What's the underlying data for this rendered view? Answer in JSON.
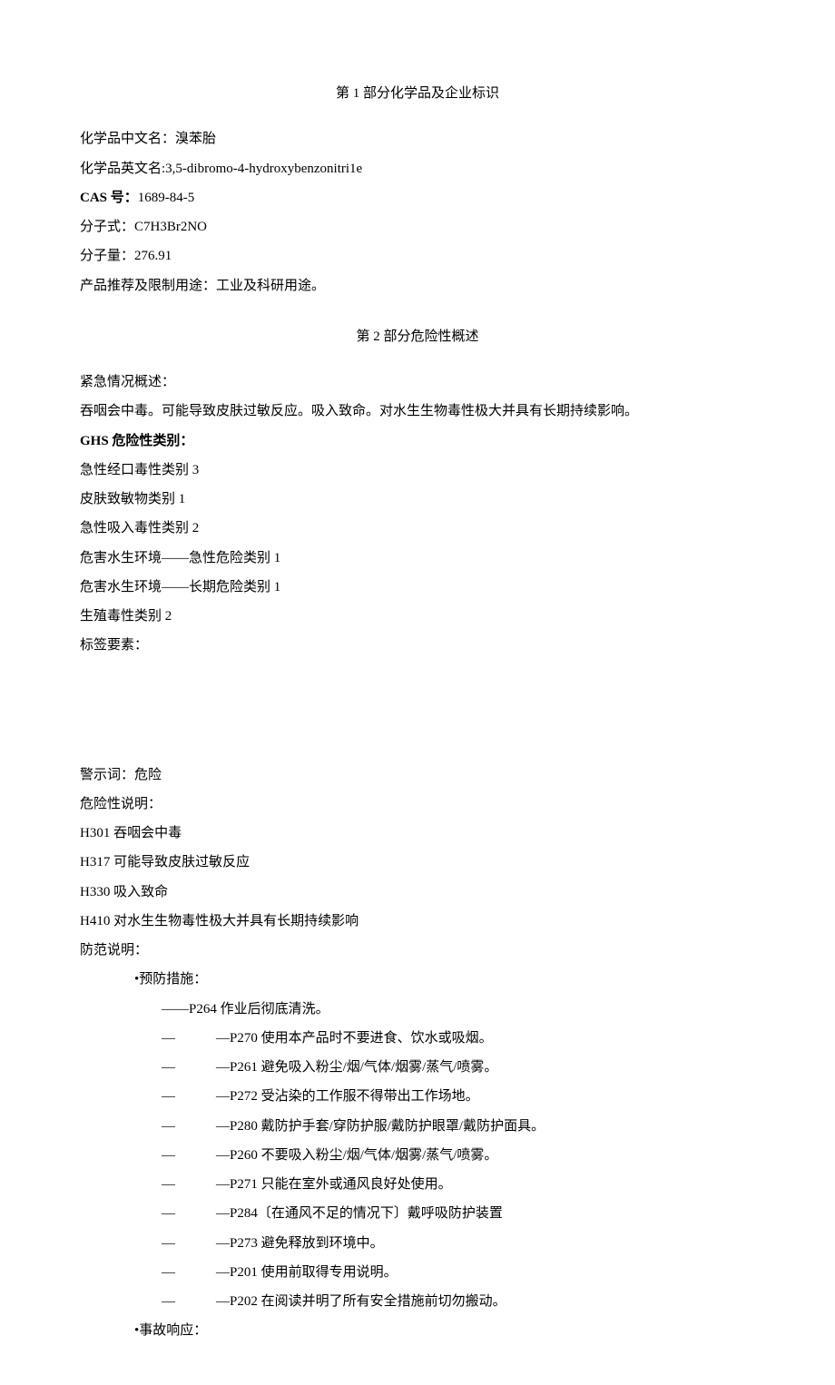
{
  "section1": {
    "title": "第 1 部分化学品及企业标识",
    "name_cn_label": "化学品中文名：",
    "name_cn": "溴苯胎",
    "name_en_label": "化学品英文名:",
    "name_en": "3,5-dibromo-4-hydroxybenzonitri1e",
    "cas_label": "CAS 号：",
    "cas": "1689-84-5",
    "formula_label": "分子式：",
    "formula": "C7H3Br2NO",
    "mw_label": "分子量：",
    "mw": "276.91",
    "usage_label": "产品推荐及限制用途：",
    "usage": "工业及科研用途。"
  },
  "section2": {
    "title": "第 2 部分危险性概述",
    "emergency_label": "紧急情况概述：",
    "emergency_text": "吞咽会中毒。可能导致皮肤过敏反应。吸入致命。对水生生物毒性极大并具有长期持续影响。",
    "ghs_label": "GHS 危险性类别：",
    "ghs_items": [
      "急性经口毒性类别 3",
      "皮肤致敏物类别 1",
      "急性吸入毒性类别 2",
      "危害水生环境——急性危险类别 1",
      "危害水生环境——长期危险类别 1",
      "生殖毒性类别 2"
    ],
    "label_elements": "标签要素：",
    "signal_label": "警示词：",
    "signal": "危险",
    "hazard_label": "危险性说明：",
    "hazard_statements": [
      "H301 吞咽会中毒",
      "H317 可能导致皮肤过敏反应",
      "H330 吸入致命",
      "H410 对水生生物毒性极大并具有长期持续影响"
    ],
    "precaution_label": "防范说明：",
    "prevention_header": "•预防措施：",
    "prevention_first": "——P264 作业后彻底清洗。",
    "prevention_items": [
      "—P270 使用本产品时不要进食、饮水或吸烟。",
      "—P261 避免吸入粉尘/烟/气体/烟雾/蒸气/喷雾。",
      "—P272 受沾染的工作服不得带出工作场地。",
      "—P280 戴防护手套/穿防护服/戴防护眼罩/戴防护面具。",
      "—P260 不要吸入粉尘/烟/气体/烟雾/蒸气/喷雾。",
      "—P271 只能在室外或通风良好处使用。",
      "—P284〔在通风不足的情况下〕戴呼吸防护装置",
      "—P273 避免释放到环境中。",
      "—P201 使用前取得专用说明。",
      "—P202 在阅读并明了所有安全措施前切勿搬动。"
    ],
    "response_header": "•事故响应："
  }
}
